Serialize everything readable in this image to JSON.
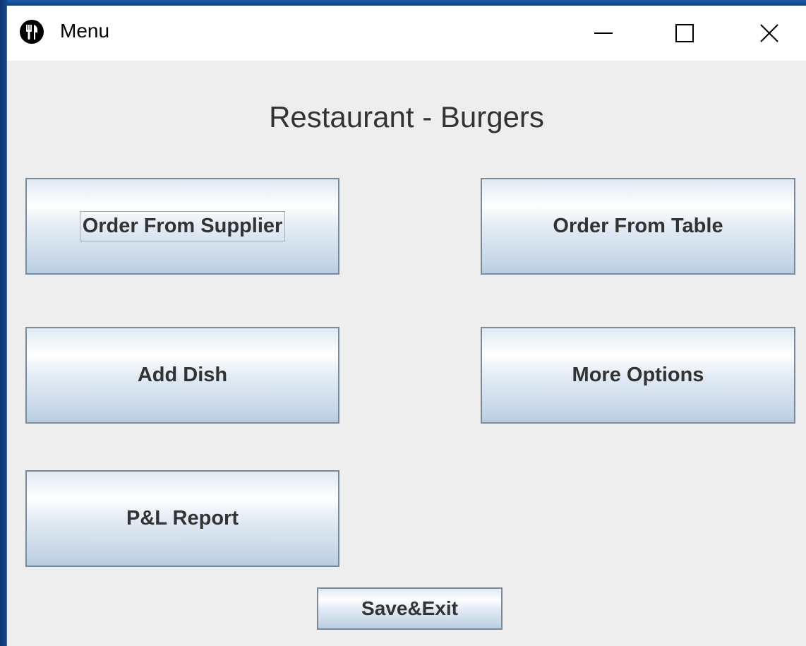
{
  "window": {
    "title": "Menu",
    "icon": "fork-knife-icon",
    "controls": {
      "minimize": "minimize-icon",
      "maximize": "maximize-icon",
      "close": "close-icon"
    }
  },
  "main": {
    "heading": "Restaurant - Burgers",
    "buttons": {
      "order_from_supplier": "Order From Supplier",
      "order_from_table": "Order From Table",
      "add_dish": "Add Dish",
      "more_options": "More Options",
      "pl_report": "P&L Report",
      "save_exit": "Save&Exit"
    }
  },
  "colors": {
    "window_background": "#eeeeee",
    "titlebar_background": "#ffffff",
    "button_text": "#333333",
    "button_border": "#7a8a99",
    "desktop_background": "#0f3a7a"
  }
}
